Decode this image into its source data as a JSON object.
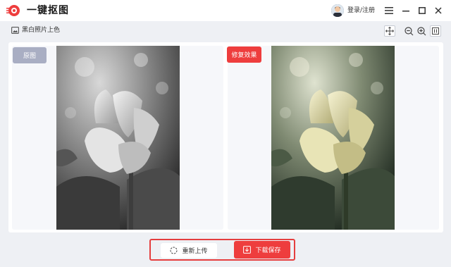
{
  "app": {
    "title": "一键抠图"
  },
  "header": {
    "login_label": "登录/注册"
  },
  "toolbar": {
    "mode_label": "黑白照片上色"
  },
  "panes": {
    "original_tag": "原图",
    "result_tag": "修复效果"
  },
  "actions": {
    "reupload_label": "重新上传",
    "save_label": "下载保存"
  },
  "colors": {
    "accent": "#ee3d3d",
    "tag_gray": "#a9aec3",
    "frame_red": "#e53e3e"
  },
  "icons": [
    "app-logo-icon",
    "avatar",
    "menu-icon",
    "minimize-icon",
    "maximize-icon",
    "close-icon",
    "image-mode-icon",
    "move-icon",
    "zoom-out-icon",
    "zoom-in-icon",
    "compare-icon",
    "refresh-icon",
    "download-icon"
  ]
}
